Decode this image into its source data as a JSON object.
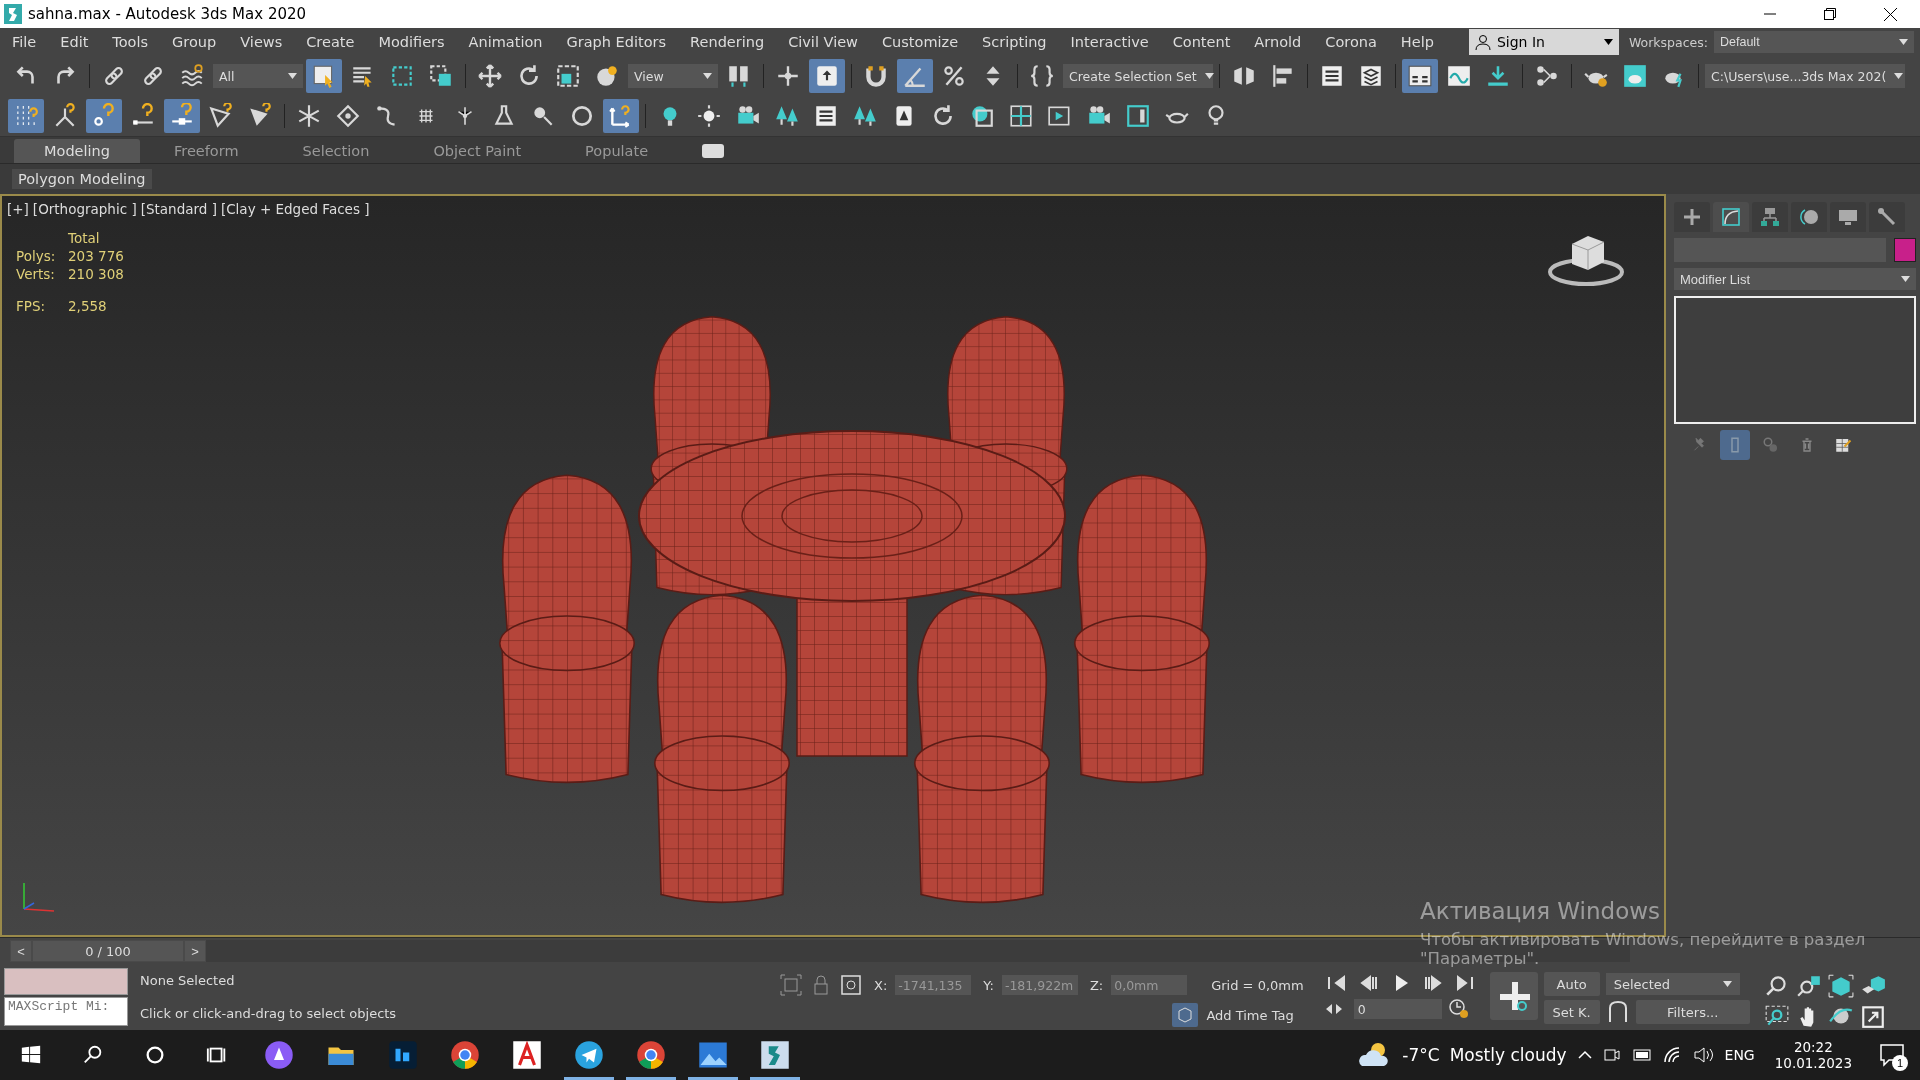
{
  "window": {
    "title": "sahna.max - Autodesk 3ds Max 2020"
  },
  "menu": [
    "File",
    "Edit",
    "Tools",
    "Group",
    "Views",
    "Create",
    "Modifiers",
    "Animation",
    "Graph Editors",
    "Rendering",
    "Civil View",
    "Customize",
    "Scripting",
    "Interactive",
    "Content",
    "Arnold",
    "Corona",
    "Help"
  ],
  "sign_in": "Sign In",
  "workspaces": {
    "label": "Workspaces:",
    "value": "Default"
  },
  "main_toolbar": [
    {
      "kind": "tool",
      "on": false
    },
    {
      "kind": "tool",
      "on": false
    },
    {
      "kind": "sep"
    },
    {
      "kind": "tool",
      "on": false
    },
    {
      "kind": "tool",
      "on": false
    },
    {
      "kind": "tool",
      "on": false
    },
    {
      "kind": "dropdown",
      "value": "All"
    },
    {
      "kind": "tool",
      "on": true
    },
    {
      "kind": "tool",
      "on": false
    },
    {
      "kind": "tool",
      "on": false
    },
    {
      "kind": "tool",
      "on": false
    },
    {
      "kind": "sep"
    },
    {
      "kind": "tool",
      "on": false
    },
    {
      "kind": "tool",
      "on": false
    },
    {
      "kind": "tool",
      "on": false
    },
    {
      "kind": "tool",
      "on": false
    },
    {
      "kind": "dropdown",
      "value": "View"
    },
    {
      "kind": "tool",
      "on": false
    },
    {
      "kind": "sep"
    },
    {
      "kind": "tool",
      "on": false
    },
    {
      "kind": "tool",
      "on": true
    },
    {
      "kind": "sep"
    },
    {
      "kind": "tool",
      "on": false
    },
    {
      "kind": "tool",
      "on": true
    },
    {
      "kind": "tool",
      "on": false
    },
    {
      "kind": "tool",
      "on": false
    },
    {
      "kind": "sep"
    },
    {
      "kind": "tool",
      "on": false
    },
    {
      "kind": "dropdown",
      "value": "Create Selection Set"
    },
    {
      "kind": "sep"
    },
    {
      "kind": "tool",
      "on": false
    },
    {
      "kind": "tool",
      "on": false
    },
    {
      "kind": "sep"
    },
    {
      "kind": "tool",
      "on": false
    },
    {
      "kind": "tool",
      "on": false
    },
    {
      "kind": "sep"
    },
    {
      "kind": "tool",
      "on": true
    },
    {
      "kind": "tool",
      "on": false
    },
    {
      "kind": "tool",
      "on": false
    },
    {
      "kind": "sep"
    },
    {
      "kind": "tool",
      "on": false
    },
    {
      "kind": "sep"
    },
    {
      "kind": "tool",
      "on": false
    },
    {
      "kind": "tool",
      "on": false
    },
    {
      "kind": "tool",
      "on": false
    },
    {
      "kind": "sep"
    },
    {
      "kind": "dropdown",
      "value": "C:\\Users\\use...3ds Max 202("
    }
  ],
  "second_toolbar": [
    {
      "kind": "tool",
      "on": true
    },
    {
      "kind": "tool",
      "on": false
    },
    {
      "kind": "tool",
      "on": true
    },
    {
      "kind": "tool",
      "on": false
    },
    {
      "kind": "tool",
      "on": true
    },
    {
      "kind": "tool",
      "on": false
    },
    {
      "kind": "tool",
      "on": false
    },
    {
      "kind": "sep"
    },
    {
      "kind": "tool",
      "on": false
    },
    {
      "kind": "tool",
      "on": false
    },
    {
      "kind": "tool",
      "on": false
    },
    {
      "kind": "tool",
      "on": false
    },
    {
      "kind": "tool",
      "on": false
    },
    {
      "kind": "tool",
      "on": false
    },
    {
      "kind": "tool",
      "on": false
    },
    {
      "kind": "tool",
      "on": false
    },
    {
      "kind": "tool",
      "on": true
    },
    {
      "kind": "sep"
    },
    {
      "kind": "tool",
      "on": false
    },
    {
      "kind": "tool",
      "on": false
    },
    {
      "kind": "tool",
      "on": false
    },
    {
      "kind": "tool",
      "on": false
    },
    {
      "kind": "tool",
      "on": false
    },
    {
      "kind": "tool",
      "on": false
    },
    {
      "kind": "tool",
      "on": false
    },
    {
      "kind": "tool",
      "on": false
    },
    {
      "kind": "tool",
      "on": false
    },
    {
      "kind": "tool",
      "on": false
    },
    {
      "kind": "tool",
      "on": false
    },
    {
      "kind": "tool",
      "on": false
    },
    {
      "kind": "tool",
      "on": false
    },
    {
      "kind": "tool",
      "on": false
    },
    {
      "kind": "tool",
      "on": false
    }
  ],
  "ribbon": {
    "tabs": [
      {
        "label": "Modeling",
        "selected": true
      },
      {
        "label": "Freeform",
        "selected": false
      },
      {
        "label": "Selection",
        "selected": false
      },
      {
        "label": "Object Paint",
        "selected": false
      },
      {
        "label": "Populate",
        "selected": false
      }
    ],
    "panel": "Polygon Modeling"
  },
  "viewport": {
    "labels": [
      "[+]",
      "[Orthographic ]",
      "[Standard ]",
      "[Clay + Edged Faces ]"
    ],
    "stats": {
      "header": "Total",
      "rows": [
        {
          "label": "Polys:",
          "value": "203 776"
        },
        {
          "label": "Verts:",
          "value": "210 308"
        }
      ],
      "fps": {
        "label": "FPS:",
        "value": "2,558"
      }
    }
  },
  "command_panel": {
    "tabs": [
      {
        "selected": false
      },
      {
        "selected": true
      },
      {
        "selected": false
      },
      {
        "selected": false
      },
      {
        "selected": false
      },
      {
        "selected": false
      }
    ],
    "modifier_list": "Modifier List",
    "stack_tools": [
      {
        "on": false
      },
      {
        "on": true
      },
      {
        "on": false
      },
      {
        "on": false
      },
      {
        "on": false
      }
    ]
  },
  "time_slider": {
    "prev": "<",
    "value": "0 / 100",
    "level": 0,
    "next": ">"
  },
  "status": {
    "listener": "MAXScript Mi:",
    "selection": "None Selected",
    "prompt": "Click or click-and-drag to select objects",
    "coords": [
      {
        "label": "X:",
        "value": "-1741,135",
        "disabled": true
      },
      {
        "label": "Y:",
        "value": "-181,922m",
        "disabled": true
      },
      {
        "label": "Z:",
        "value": "0,0mm",
        "disabled": true
      }
    ],
    "grid": "Grid = 0,0mm",
    "time_tag": "Add Time Tag",
    "frame": "0",
    "auto": "Auto",
    "key_mode": "Selected",
    "set_key": "Set K.",
    "filters": "Filters..."
  },
  "activation": {
    "title": "Активация Windows",
    "line1": "Чтобы активировать Windows, перейдите в раздел",
    "line2": "\"Параметры\"."
  },
  "taskbar": {
    "apps": [
      {
        "active": false
      },
      {
        "active": false
      },
      {
        "active": false
      },
      {
        "active": false
      },
      {
        "active": false
      },
      {
        "active": true
      },
      {
        "active": true
      },
      {
        "active": true
      },
      {
        "active": true
      }
    ],
    "temperature": "-7°C",
    "weather": "Mostly cloudy",
    "language": "ENG",
    "time": "20:22",
    "date": "10.01.2023",
    "notifications": "1"
  }
}
